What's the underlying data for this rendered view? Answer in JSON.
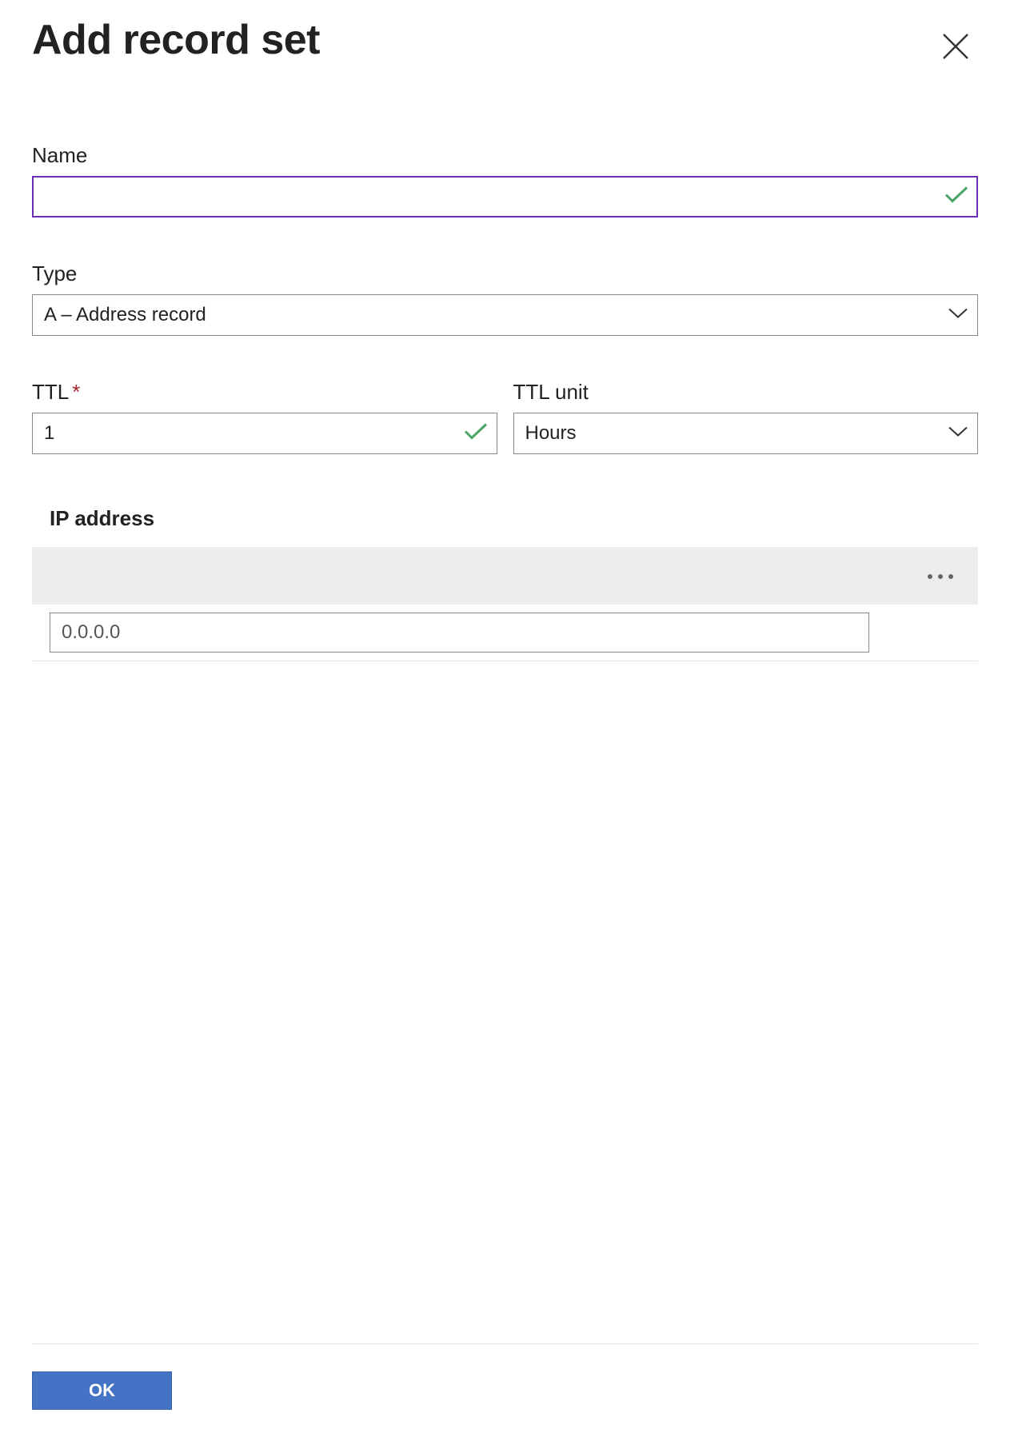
{
  "header": {
    "title": "Add record set"
  },
  "fields": {
    "name": {
      "label": "Name",
      "value": ""
    },
    "type": {
      "label": "Type",
      "value": "A – Address record"
    },
    "ttl": {
      "label": "TTL",
      "value": "1"
    },
    "ttl_unit": {
      "label": "TTL unit",
      "value": "Hours"
    }
  },
  "ip_section": {
    "label": "IP address",
    "placeholder": "0.0.0.0"
  },
  "footer": {
    "ok_label": "OK"
  }
}
